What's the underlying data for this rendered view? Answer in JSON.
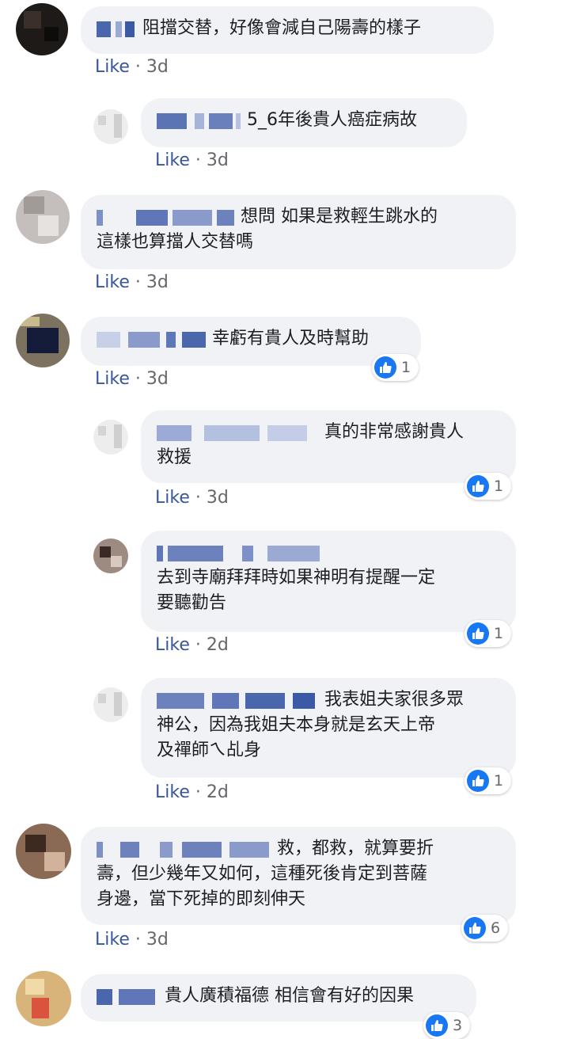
{
  "comments": [
    {
      "id": "c1",
      "text": "阻擋交替，好像會減自己陽壽的樣子",
      "meta": {
        "like": "Like",
        "time": "3d"
      }
    },
    {
      "id": "c2",
      "text": "5_6年後貴人癌症病故",
      "meta": {
        "like": "Like",
        "time": "3d"
      }
    },
    {
      "id": "c3",
      "text_line1": "想問 如果是救輕生跳水的",
      "text_line2": "這樣也算擋人交替嗎",
      "meta": {
        "like": "Like",
        "time": "3d"
      }
    },
    {
      "id": "c4",
      "text": "幸虧有貴人及時幫助",
      "meta": {
        "like": "Like",
        "time": "3d"
      },
      "reactions": {
        "icon": "thumbs-up-icon",
        "count": "1"
      }
    },
    {
      "id": "c5",
      "text_line1": "真的非常感謝貴人",
      "text_line2": "救援",
      "meta": {
        "like": "Like",
        "time": "3d"
      },
      "reactions": {
        "icon": "thumbs-up-icon",
        "count": "1"
      }
    },
    {
      "id": "c6",
      "text_line1": "去到寺廟拜拜時如果神明有提醒一定",
      "text_line2": "要聽勸告",
      "meta": {
        "like": "Like",
        "time": "2d"
      },
      "reactions": {
        "icon": "thumbs-up-icon",
        "count": "1"
      }
    },
    {
      "id": "c7",
      "text_line1": "我表姐夫家很多眾",
      "text_line2": "神公，因為我姐夫本身就是玄天上帝",
      "text_line3": "及禪師ㄟ乩身",
      "meta": {
        "like": "Like",
        "time": "2d"
      },
      "reactions": {
        "icon": "thumbs-up-icon",
        "count": "1"
      }
    },
    {
      "id": "c8",
      "text_line1": "救，都救，就算要折",
      "text_line2": "壽，但少幾年又如何，這種死後肯定到菩薩",
      "text_line3": "身邊，當下死掉的即刻伸天",
      "meta": {
        "like": "Like",
        "time": "3d"
      },
      "reactions": {
        "icon": "thumbs-up-icon",
        "count": "6"
      }
    },
    {
      "id": "c9",
      "text": "貴人廣積福德 相信會有好的因果",
      "reactions": {
        "icon": "thumbs-up-icon",
        "count": "3"
      }
    }
  ],
  "colors": {
    "bubble": "#f0f2f5",
    "like_link": "#385898",
    "meta": "#65676b",
    "reaction_blue": "#1877f2"
  }
}
